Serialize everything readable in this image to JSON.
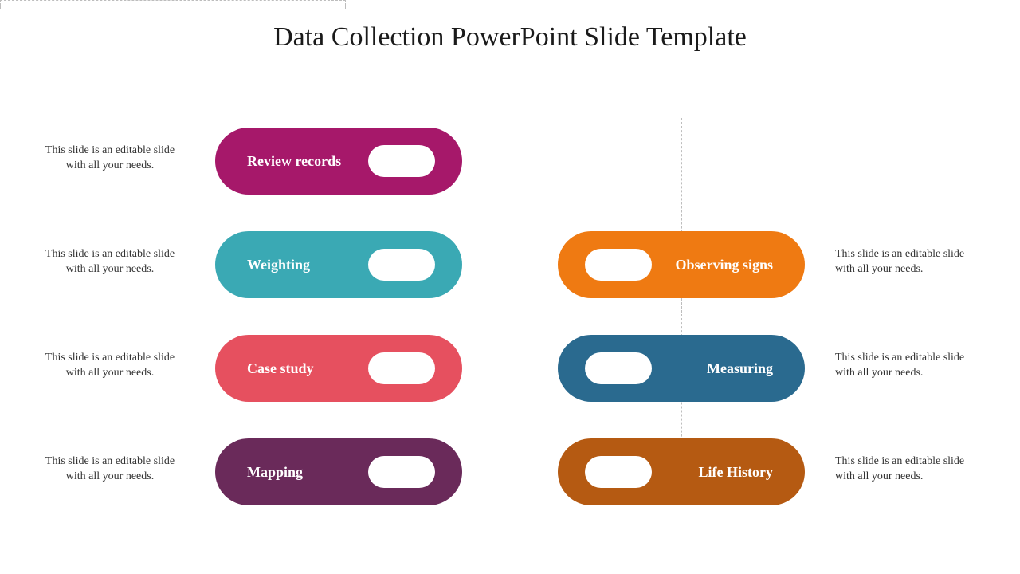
{
  "title": "Data Collection PowerPoint Slide Template",
  "caption_text": "This slide is an editable slide with all your needs.",
  "left_pills": [
    {
      "label": "Review records",
      "color": "#a6186a"
    },
    {
      "label": "Weighting",
      "color": "#3aa9b4"
    },
    {
      "label": "Case study",
      "color": "#e6505f"
    },
    {
      "label": "Mapping",
      "color": "#6a2a5a"
    }
  ],
  "right_pills": [
    {
      "label": "Observing signs",
      "color": "#ef7a12"
    },
    {
      "label": "Measuring",
      "color": "#2a6a8f"
    },
    {
      "label": "Life History",
      "color": "#b55a12"
    }
  ]
}
